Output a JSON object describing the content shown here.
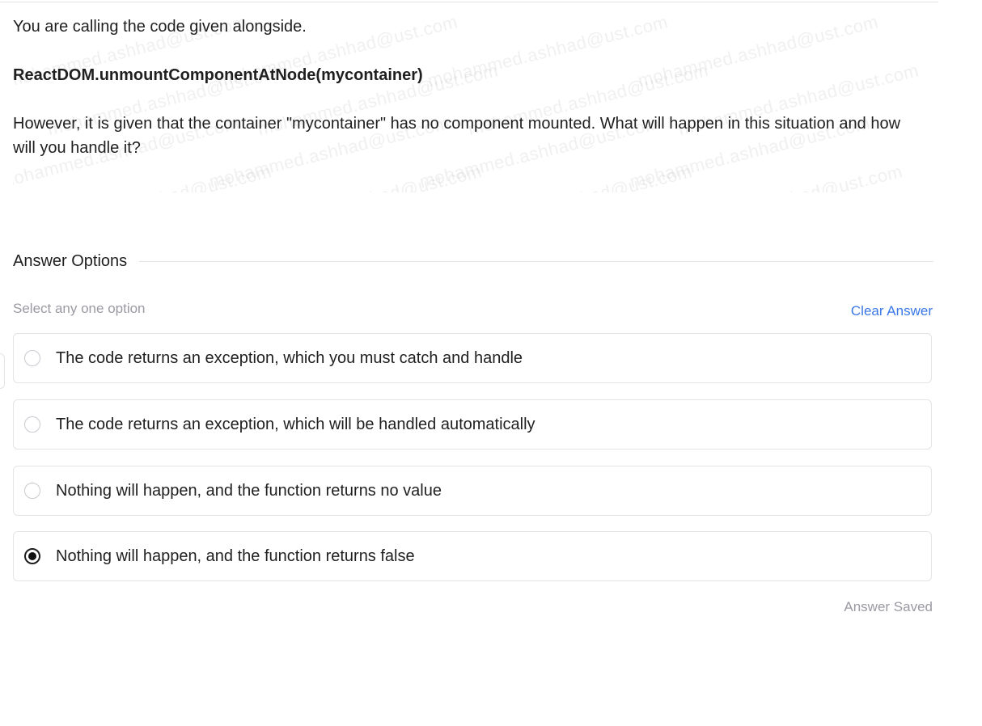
{
  "question": {
    "line1": "You are calling the code given alongside.",
    "code": "ReactDOM.unmountComponentAtNode(mycontainer)",
    "line3": "However, it is given that the container \"mycontainer\" has no component mounted. What will happen in this situation and how will you handle it?"
  },
  "watermark": {
    "text": "mohammed.ashhad@ust.com"
  },
  "answers": {
    "section_title": "Answer Options",
    "hint": "Select any one option",
    "clear_label": "Clear Answer",
    "options": [
      {
        "label": "The code returns an exception, which you must catch and handle",
        "selected": false
      },
      {
        "label": "The code returns an exception, which will be handled automatically",
        "selected": false
      },
      {
        "label": "Nothing will happen, and the function returns no value",
        "selected": false
      },
      {
        "label": "Nothing will happen, and the function returns false",
        "selected": true
      }
    ],
    "status": "Answer Saved"
  },
  "colors": {
    "accent_link": "#3b78e7",
    "muted_text": "#9a9aa3",
    "border": "#e4e4e7"
  }
}
